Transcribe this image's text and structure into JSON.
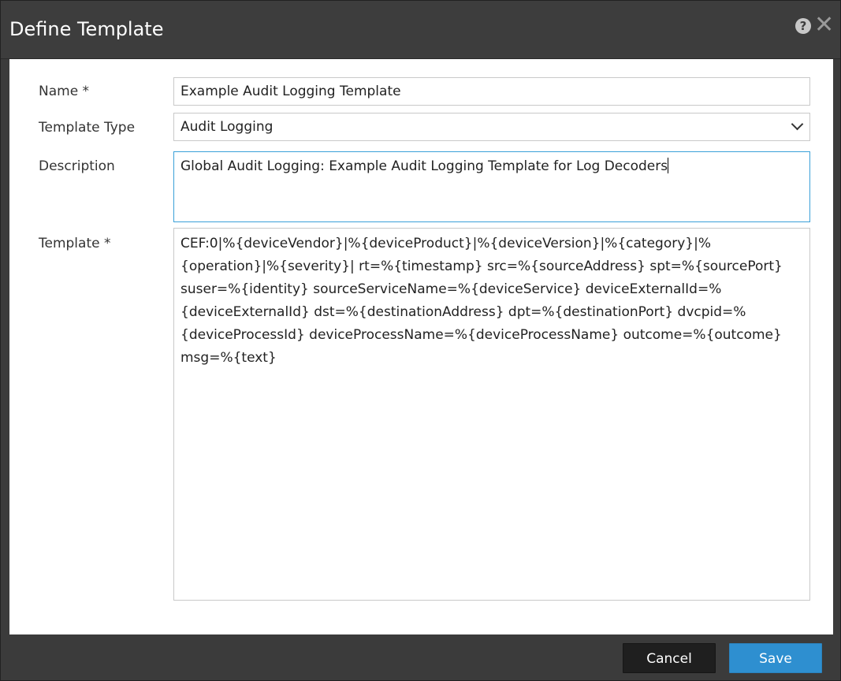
{
  "window": {
    "title": "Define Template",
    "help_icon": "question-circle-icon",
    "close_icon": "close-icon",
    "help_glyph": "?",
    "close_glyph": "✕"
  },
  "form": {
    "name_label": "Name *",
    "name_value": "Example Audit Logging Template",
    "type_label": "Template Type",
    "type_value": "Audit Logging",
    "description_label": "Description",
    "description_value": "Global Audit Logging: Example Audit Logging Template for Log Decoders",
    "template_label": "Template *",
    "template_value": "CEF:0|%{deviceVendor}|%{deviceProduct}|%{deviceVersion}|%{category}|%{operation}|%{severity}| rt=%{timestamp} src=%{sourceAddress} spt=%{sourcePort} suser=%{identity} sourceServiceName=%{deviceService} deviceExternalId=%{deviceExternalId} dst=%{destinationAddress} dpt=%{destinationPort} dvcpid=%{deviceProcessId} deviceProcessName=%{deviceProcessName} outcome=%{outcome} msg=%{text}"
  },
  "footer": {
    "cancel_label": "Cancel",
    "save_label": "Save"
  },
  "colors": {
    "title_bar": "#3d3d3d",
    "save_button": "#2e8fd0",
    "cancel_button": "#1f1f1f",
    "focus_border": "#3aa0d8"
  }
}
